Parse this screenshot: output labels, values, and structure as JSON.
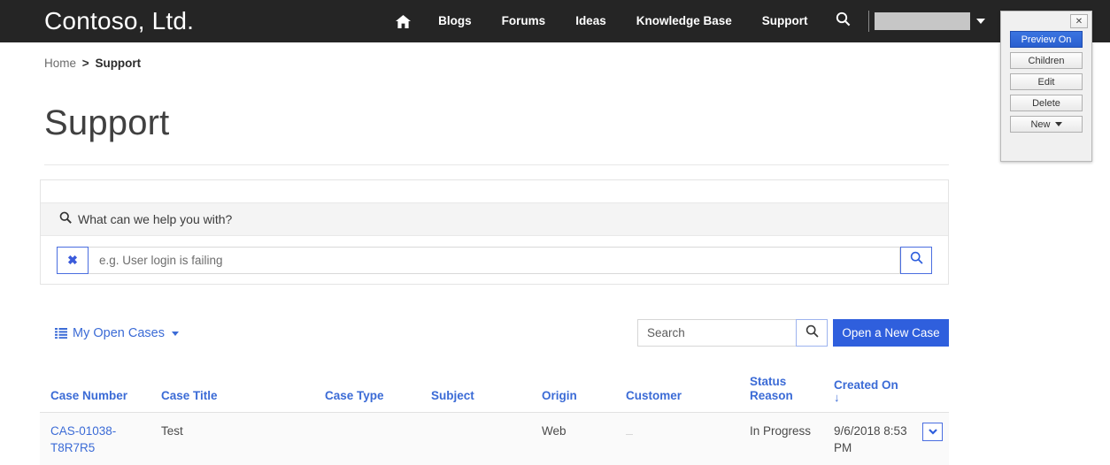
{
  "navbar": {
    "brand": "Contoso, Ltd.",
    "home_icon": "home-icon",
    "links": [
      "Blogs",
      "Forums",
      "Ideas",
      "Knowledge Base",
      "Support"
    ],
    "search_icon": "search-icon",
    "user_caret_icon": "chevron-down-icon"
  },
  "breadcrumb": {
    "home": "Home",
    "separator": ">",
    "current": "Support"
  },
  "page": {
    "title": "Support"
  },
  "help_search": {
    "heading": "What can we help you with?",
    "heading_icon": "search-icon",
    "clear_label": "✖",
    "input_value": "",
    "input_placeholder": "e.g. User login is failing",
    "submit_icon": "search-icon"
  },
  "toolbar": {
    "view_label": "My Open Cases",
    "view_icon": "list-icon",
    "view_caret_icon": "chevron-down-icon",
    "search_value": "",
    "search_placeholder": "Search",
    "search_icon": "search-icon",
    "new_case_label": "Open a New Case"
  },
  "table": {
    "columns": [
      "Case Number",
      "Case Title",
      "Case Type",
      "Subject",
      "Origin",
      "Customer",
      "Status Reason",
      "Created On"
    ],
    "sort_column": "Created On",
    "sort_arrow": "↓",
    "rows": [
      {
        "case_number": "CAS-01038-T8R7R5",
        "case_title": "Test",
        "case_type": "",
        "subject": "",
        "origin": "Web",
        "customer": "",
        "status_reason": "In Progress",
        "created_on": "9/6/2018 8:53 PM",
        "menu_icon": "chevron-down-icon"
      }
    ]
  },
  "cms_panel": {
    "close_label": "✕",
    "buttons": [
      {
        "label": "Preview On",
        "active": true
      },
      {
        "label": "Children",
        "active": false
      },
      {
        "label": "Edit",
        "active": false
      },
      {
        "label": "Delete",
        "active": false
      },
      {
        "label": "New",
        "active": false,
        "caret": true
      }
    ]
  },
  "colors": {
    "nav_bg": "#252525",
    "accent_blue": "#3b6bd6",
    "primary_button": "#2f5fdd",
    "link_blue": "#3b6bd6",
    "panel_bg": "#f0f0f0"
  }
}
